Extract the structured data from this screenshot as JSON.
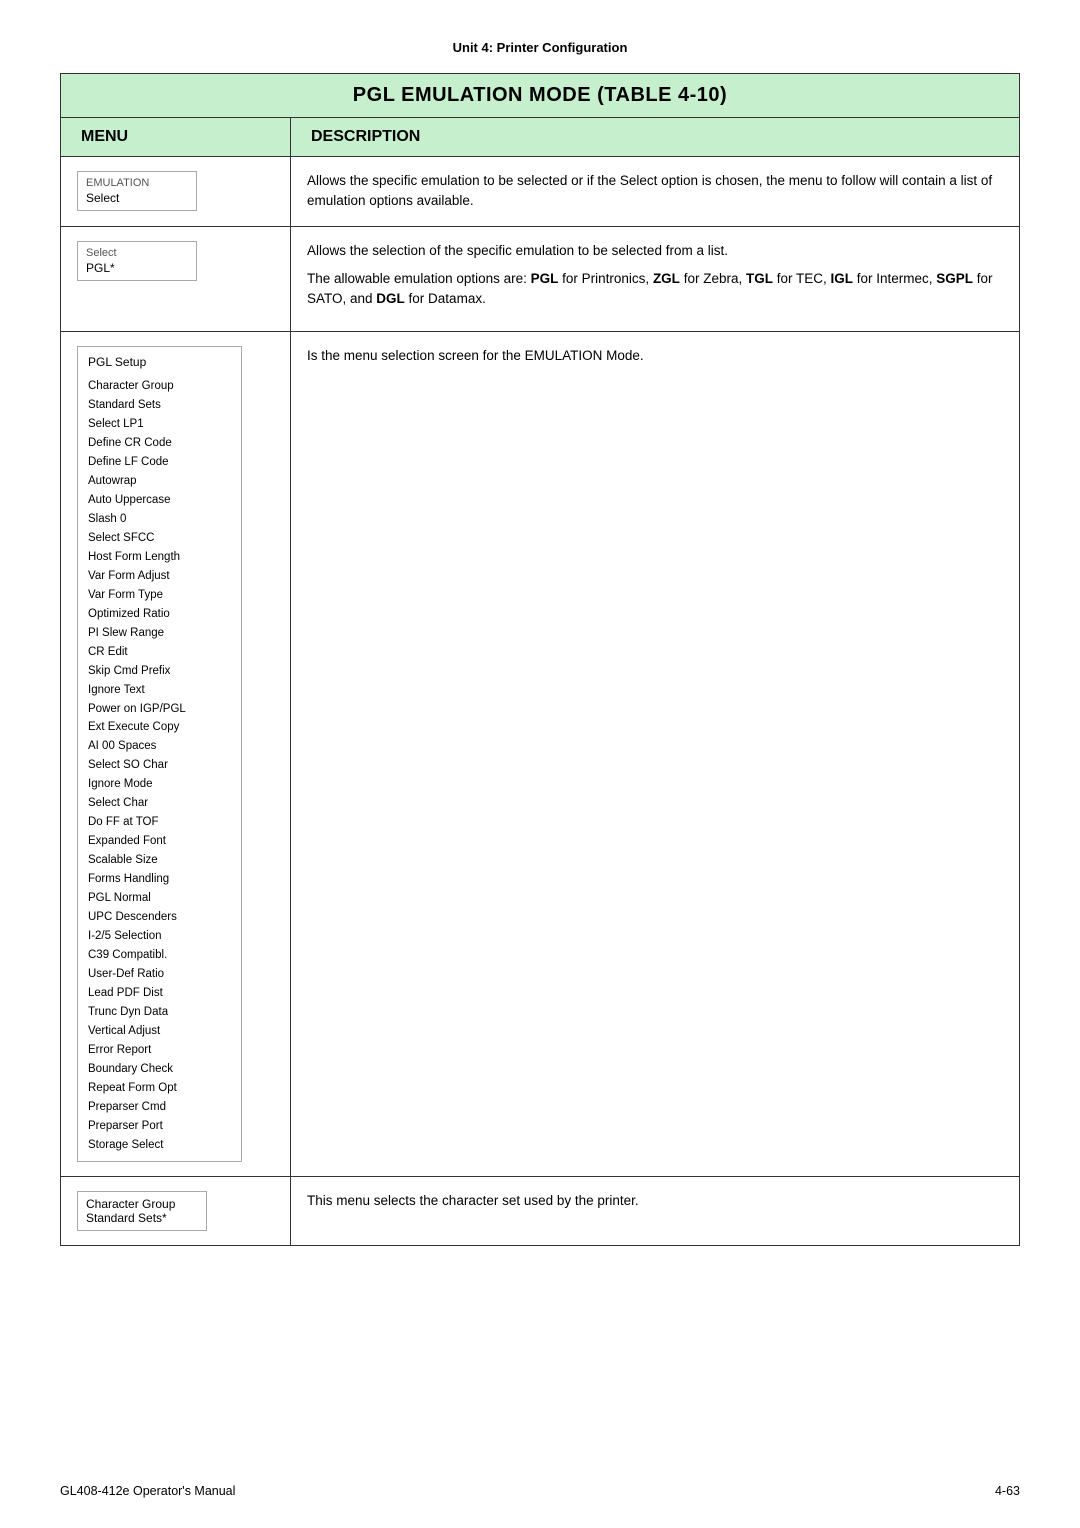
{
  "page": {
    "unit_title": "Unit 4:  Printer Configuration",
    "table_title": "PGL EMULATION MODE (TABLE 4-10)",
    "col_menu": "MENU",
    "col_description": "DESCRIPTION",
    "footer_left": "GL408-412e Operator's Manual",
    "footer_right": "4-63"
  },
  "rows": [
    {
      "menu": {
        "label": "EMULATION",
        "value": "Select"
      },
      "description": "Allows the specific emulation to be selected or if the Select option is chosen, the menu to follow will contain a list of emulation options available."
    },
    {
      "menu": {
        "label": "Select",
        "value": "PGL*"
      },
      "description_parts": [
        "Allows the selection of the specific emulation to be selected from a list.",
        "The allowable emulation options are: <b>PGL</b> for Printronics, <b>ZGL</b> for Zebra, <b>TGL</b> for TEC, <b>IGL</b> for Intermec, <b>SGPL</b> for SATO, and <b>DGL</b> for Datamax."
      ]
    },
    {
      "menu": {
        "is_pgl_setup": true,
        "title": "PGL Setup",
        "items": [
          "Character Group",
          "Standard Sets",
          "Select LP1",
          "Define CR Code",
          "Define LF Code",
          "Autowrap",
          "Auto Uppercase",
          "Slash 0",
          "Select SFCC",
          "Host Form Length",
          "Var Form Adjust",
          "Var Form Type",
          "Optimized Ratio",
          "PI Slew Range",
          "CR Edit",
          "Skip Cmd Prefix",
          "Ignore Text",
          "Power on IGP/PGL",
          "Ext Execute Copy",
          "AI 00 Spaces",
          "Select SO Char",
          "Ignore Mode",
          "Select Char",
          "Do FF at TOF",
          "Expanded Font",
          "Scalable Size",
          "Forms Handling",
          "PGL Normal",
          "UPC Descenders",
          "I-2/5 Selection",
          "C39 Compatibl.",
          "User-Def Ratio",
          "Lead PDF Dist",
          "Trunc Dyn Data",
          "Vertical Adjust",
          "Error Report",
          "Boundary Check",
          "Repeat Form Opt",
          "Preparser Cmd",
          "Preparser Port",
          "Storage Select"
        ]
      },
      "description": "Is the menu selection screen for the EMULATION Mode."
    },
    {
      "menu": {
        "label": "Character Group",
        "value": "Standard Sets*"
      },
      "description": "This menu selects the character set used by the printer."
    }
  ]
}
